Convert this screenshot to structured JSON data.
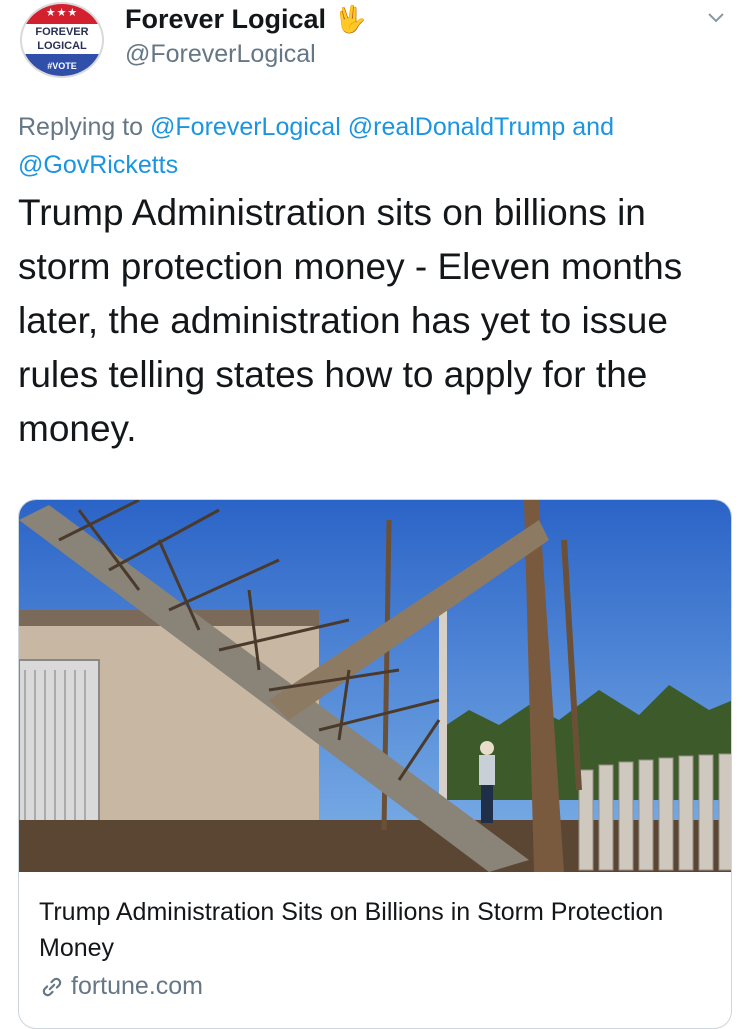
{
  "user": {
    "display_name": "Forever Logical",
    "name_emoji": "🖖",
    "handle": "@ForeverLogical",
    "avatar": {
      "stars": "★★★",
      "line1": "FOREVER",
      "line2": "LOGICAL",
      "line3": "#VOTE"
    }
  },
  "reply_context": {
    "prefix": "Replying to",
    "mention1": "@ForeverLogical",
    "mention2": "@realDonaldTrump",
    "conjunction": "and",
    "mention3": "@GovRicketts"
  },
  "tweet_text": "Trump Administration sits on billions in storm protection money - Eleven months later, the administration has yet to issue rules telling states how to apply for the money.",
  "card": {
    "title": "Trump Administration Sits on Billions in Storm Protection Money",
    "domain": "fortune.com",
    "image_icon": "storm-damage-photo"
  },
  "colors": {
    "link": "#1b95e0",
    "secondary_text": "#657786",
    "primary_text": "#14171a",
    "card_border": "#ccd6dd"
  }
}
